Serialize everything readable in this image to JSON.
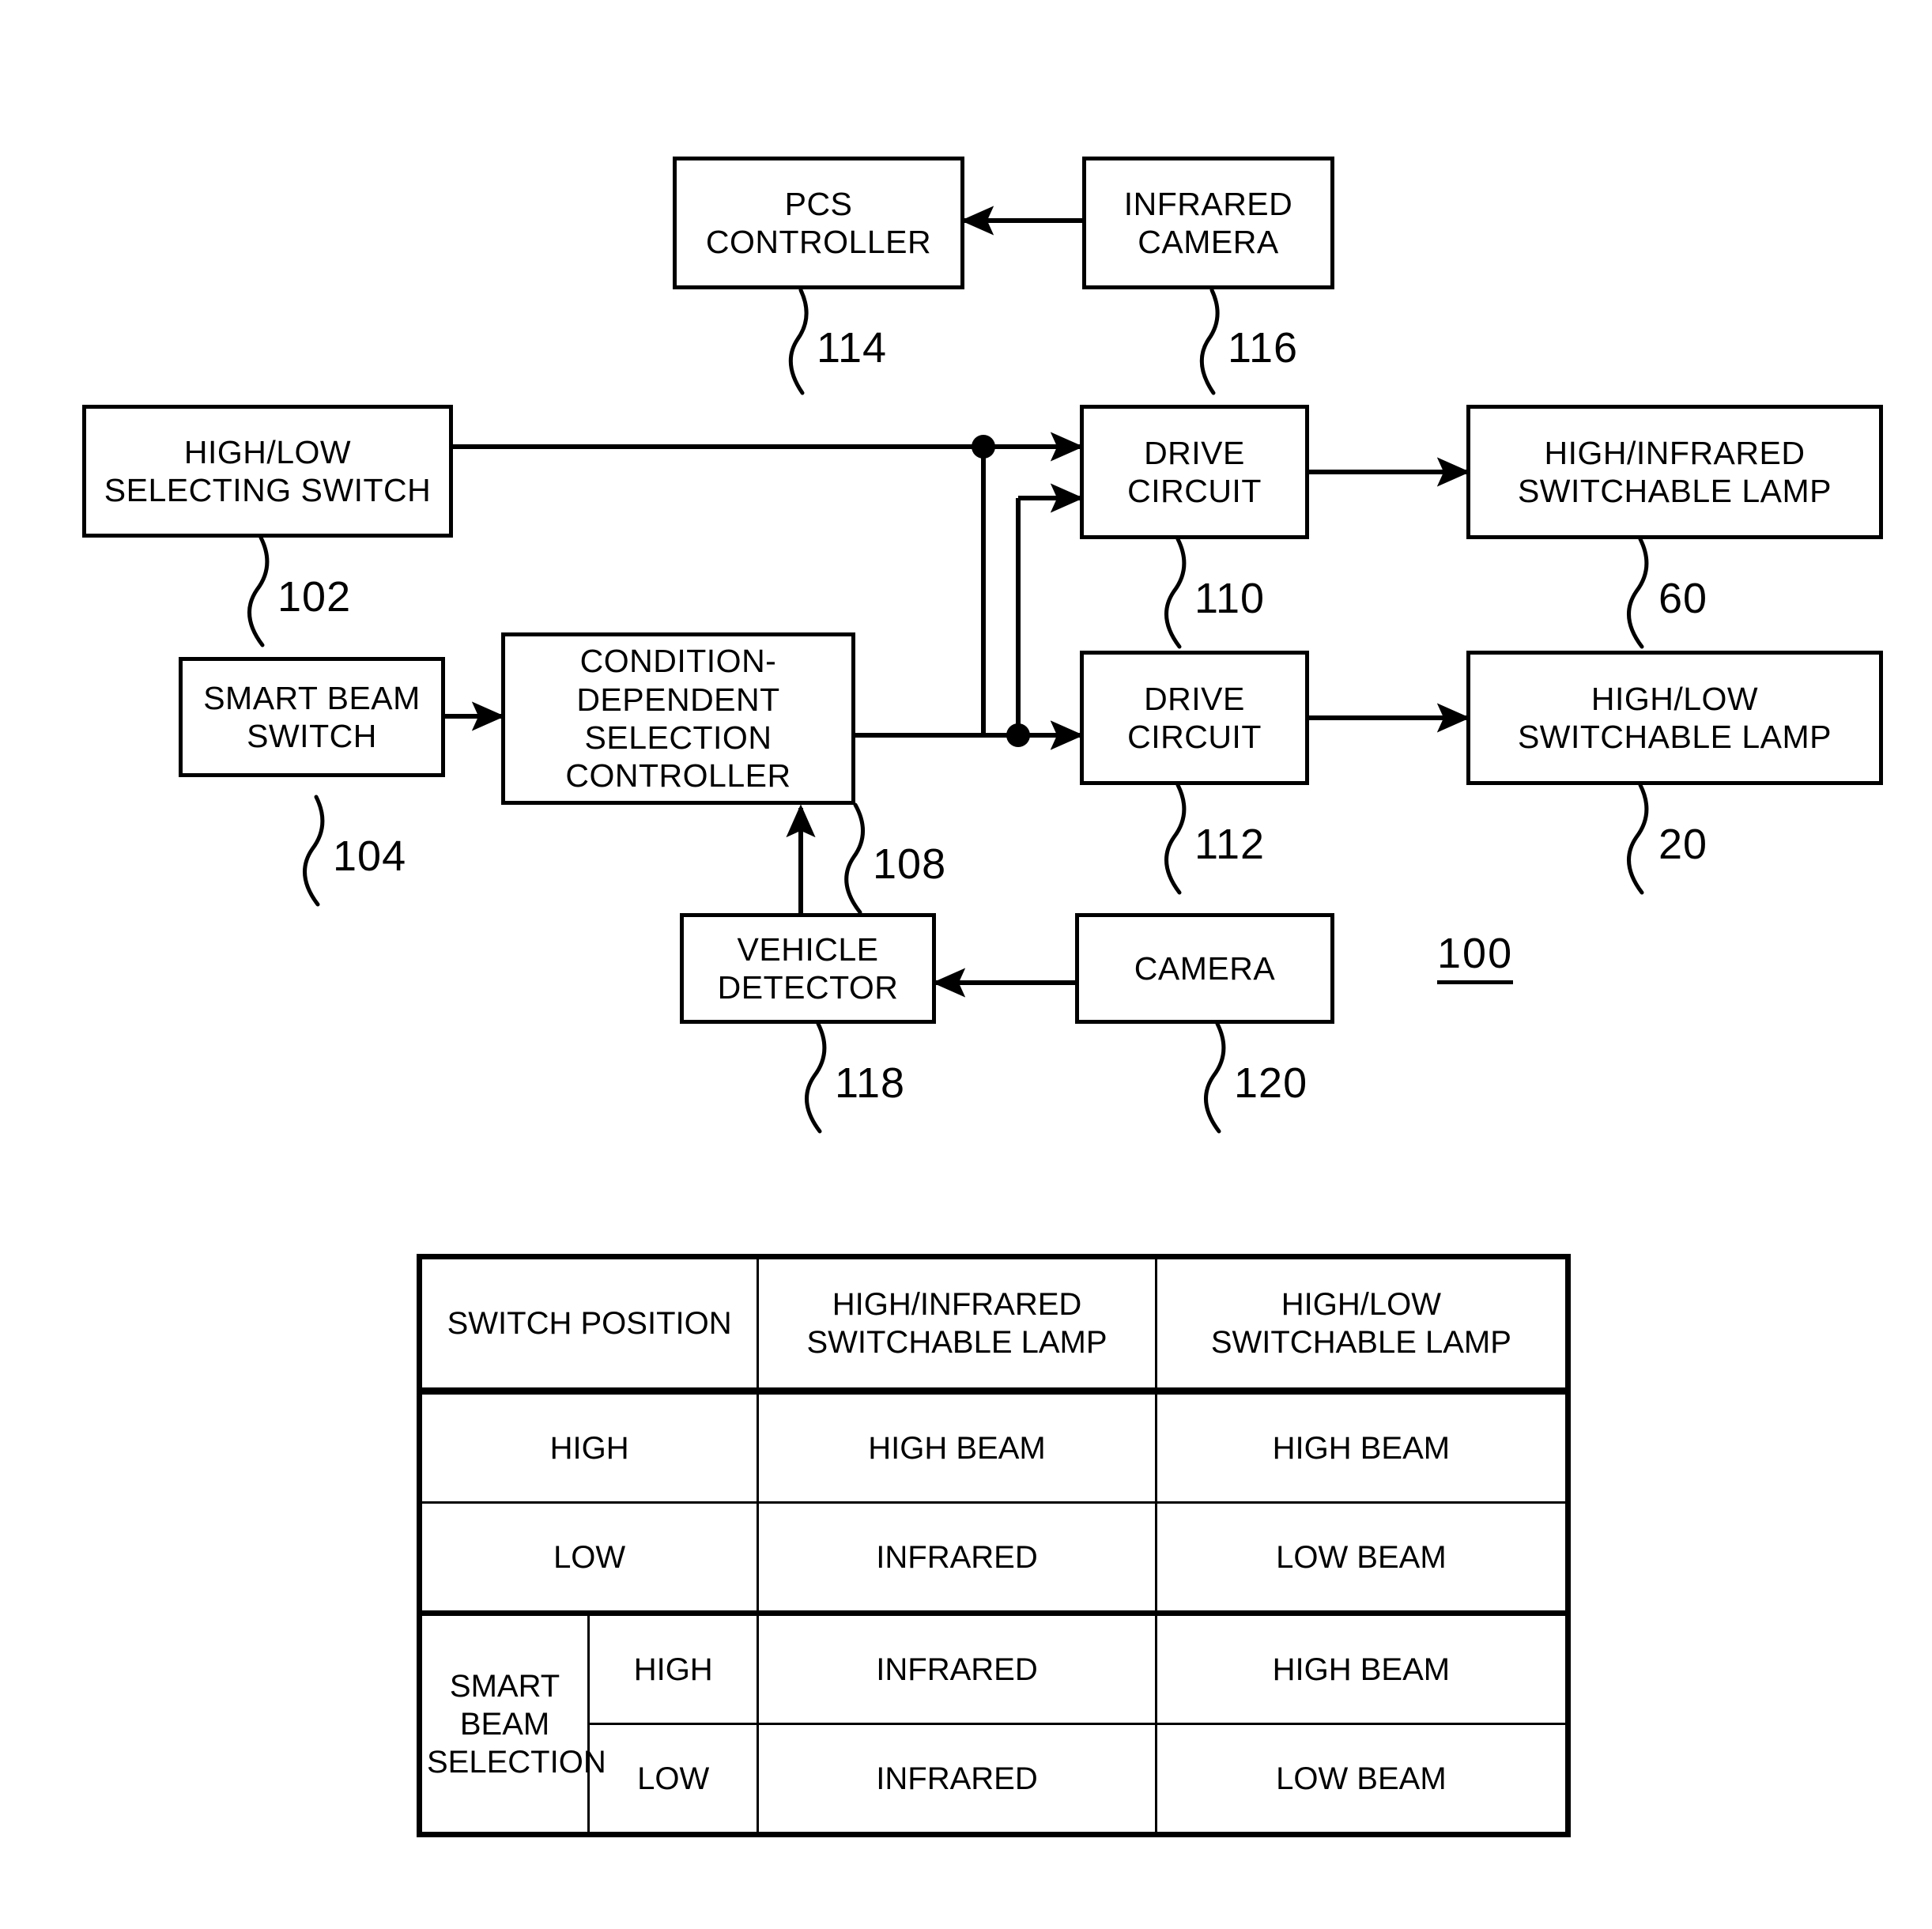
{
  "figure": {
    "main_reference": "100",
    "blocks": [
      {
        "id": "pcs_controller",
        "label": "PCS\nCONTROLLER",
        "ref": "114"
      },
      {
        "id": "infrared_camera",
        "label": "INFRARED\nCAMERA",
        "ref": "116"
      },
      {
        "id": "high_low_switch",
        "label": "HIGH/LOW\nSELECTING SWITCH",
        "ref": "102"
      },
      {
        "id": "smart_beam_switch",
        "label": "SMART BEAM\nSWITCH",
        "ref": "104"
      },
      {
        "id": "selection_ctrl",
        "label": "CONDITION-DEPENDENT\nSELECTION\nCONTROLLER",
        "ref": "108"
      },
      {
        "id": "drive_circuit_1",
        "label": "DRIVE\nCIRCUIT",
        "ref": "110"
      },
      {
        "id": "drive_circuit_2",
        "label": "DRIVE\nCIRCUIT",
        "ref": "112"
      },
      {
        "id": "lamp_hi_ir",
        "label": "HIGH/INFRARED\nSWITCHABLE LAMP",
        "ref": "60"
      },
      {
        "id": "lamp_hi_lo",
        "label": "HIGH/LOW\nSWITCHABLE LAMP",
        "ref": "20"
      },
      {
        "id": "vehicle_detector",
        "label": "VEHICLE\nDETECTOR",
        "ref": "118"
      },
      {
        "id": "camera",
        "label": "CAMERA",
        "ref": "120"
      }
    ]
  },
  "chart_data": {
    "type": "table",
    "title": "",
    "columns": [
      "SWITCH POSITION",
      "HIGH/INFRARED\nSWITCHABLE LAMP",
      "HIGH/LOW\nSWITCHABLE LAMP"
    ],
    "rows": [
      {
        "switch_position": "HIGH",
        "sub_position": "",
        "hi_ir_lamp": "HIGH BEAM",
        "hi_lo_lamp": "HIGH BEAM"
      },
      {
        "switch_position": "LOW",
        "sub_position": "",
        "hi_ir_lamp": "INFRARED",
        "hi_lo_lamp": "LOW BEAM"
      },
      {
        "switch_position": "SMART BEAM\nSELECTION",
        "sub_position": "HIGH",
        "hi_ir_lamp": "INFRARED",
        "hi_lo_lamp": "HIGH BEAM"
      },
      {
        "switch_position": "",
        "sub_position": "LOW",
        "hi_ir_lamp": "INFRARED",
        "hi_lo_lamp": "LOW BEAM"
      }
    ]
  },
  "colors": {
    "ink": "#000000",
    "paper": "#ffffff"
  }
}
